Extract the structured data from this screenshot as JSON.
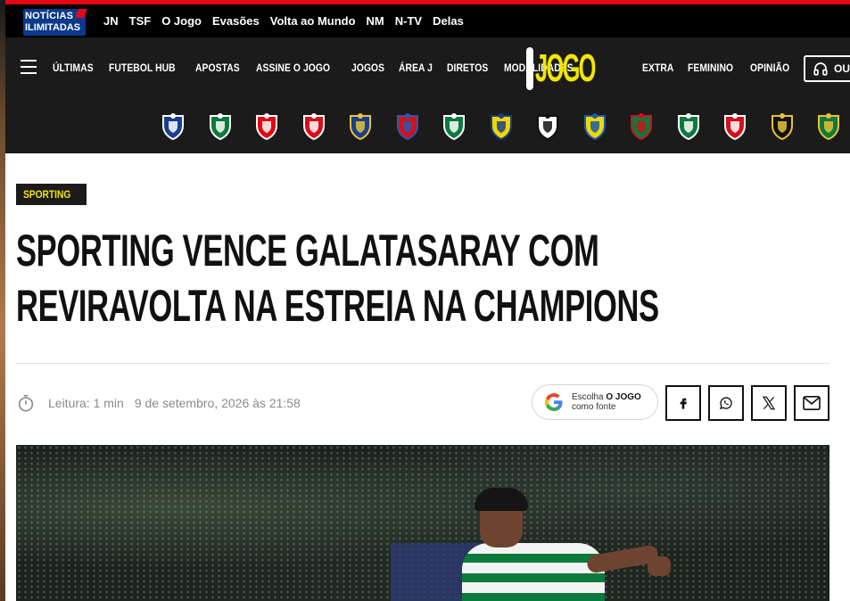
{
  "network": {
    "logo": {
      "line1": "NOTÍCIAS",
      "line2": "ILIMITADAS"
    },
    "links": [
      "JN",
      "TSF",
      "O Jogo",
      "Evasões",
      "Volta ao Mundo",
      "NM",
      "N-TV",
      "Delas"
    ]
  },
  "nav": {
    "left": [
      "ÚLTIMAS",
      "FUTEBOL HUB",
      "APOSTAS",
      "ASSINE O JOGO",
      "JOGOS",
      "ÁREA J",
      "DIRETOS",
      "MODALIDADES"
    ],
    "brand": "JOGO",
    "right": [
      "EXTRA",
      "FEMININO",
      "OPINIÃO"
    ],
    "listen_label": "OUV"
  },
  "clubs": [
    {
      "name": "fc-porto",
      "colors": [
        "#1a3e8c",
        "#ffffff"
      ]
    },
    {
      "name": "sporting",
      "colors": [
        "#0c7a3c",
        "#ffffff"
      ]
    },
    {
      "name": "benfica",
      "colors": [
        "#e30613",
        "#ffffff"
      ]
    },
    {
      "name": "braga",
      "colors": [
        "#d4101a",
        "#ffffff"
      ]
    },
    {
      "name": "famalicao",
      "colors": [
        "#1a3e8c",
        "#e8c23a"
      ]
    },
    {
      "name": "gil-vicente",
      "colors": [
        "#d4101a",
        "#2a58b0"
      ]
    },
    {
      "name": "moreirense",
      "colors": [
        "#0c7a3c",
        "#ffffff"
      ]
    },
    {
      "name": "arouca",
      "colors": [
        "#f2d600",
        "#1a3e8c"
      ]
    },
    {
      "name": "vitoria-guimaraes",
      "colors": [
        "#ffffff",
        "#111111"
      ]
    },
    {
      "name": "estoril",
      "colors": [
        "#f2d600",
        "#1a5ab0"
      ]
    },
    {
      "name": "estrela-amadora",
      "colors": [
        "#0c7a3c",
        "#d4101a"
      ]
    },
    {
      "name": "rio-ave",
      "colors": [
        "#0c7a3c",
        "#ffffff"
      ]
    },
    {
      "name": "santa-clara",
      "colors": [
        "#d4101a",
        "#ffffff"
      ]
    },
    {
      "name": "nacional",
      "colors": [
        "#111111",
        "#e8c23a"
      ]
    },
    {
      "name": "tondela",
      "colors": [
        "#0c7a3c",
        "#e8c23a"
      ]
    }
  ],
  "article": {
    "category": "SPORTING",
    "headline_line1": "SPORTING VENCE GALATASARAY COM",
    "headline_line2": "REVIRAVOLTA NA ESTREIA NA CHAMPIONS",
    "reading_time": "Leitura: 1 min",
    "date": "9 de setembro, 2026 às 21:58"
  },
  "google": {
    "prefix": "Escolha ",
    "brand": "O JOGO",
    "suffix": "como fonte"
  },
  "share": [
    "facebook",
    "whatsapp",
    "x",
    "email"
  ]
}
